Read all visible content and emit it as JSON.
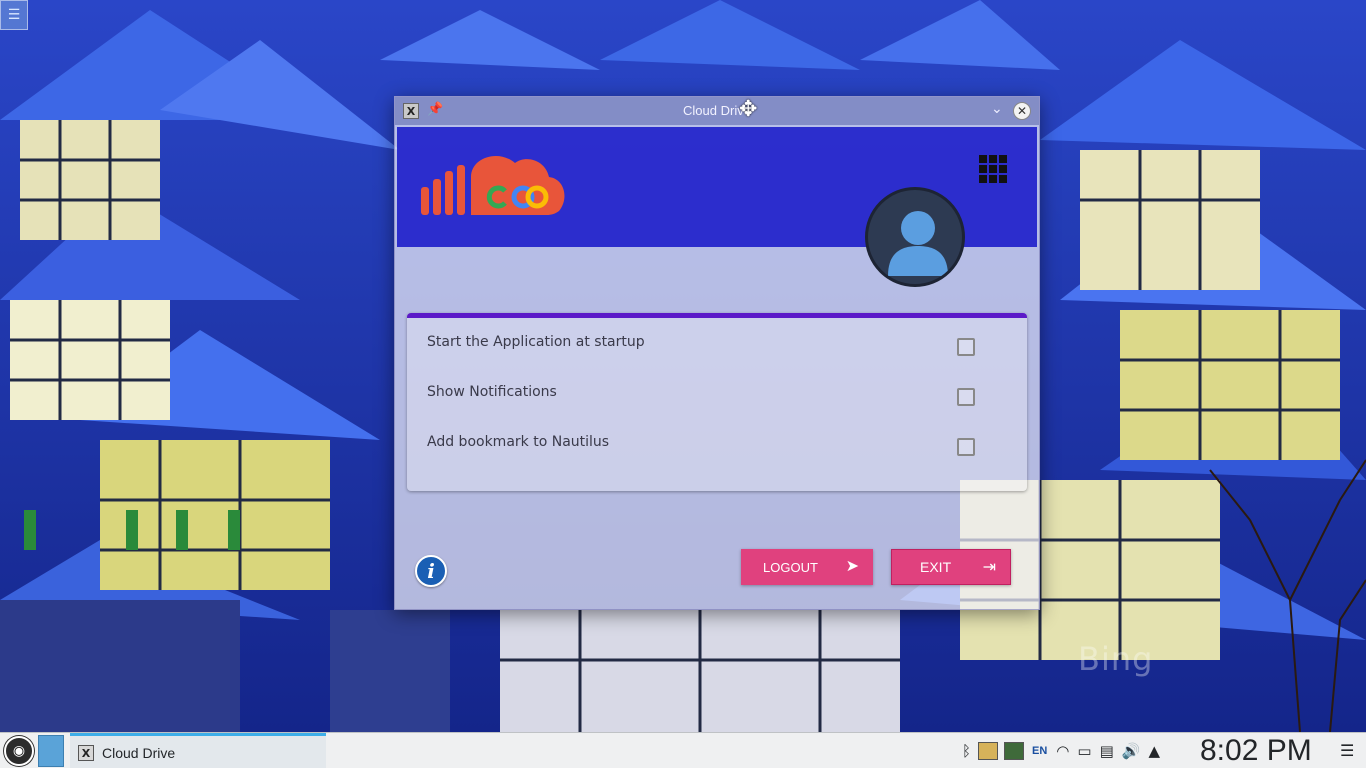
{
  "window": {
    "title": "Cloud Drive",
    "settings": [
      {
        "label": "Start the Application at startup",
        "checked": false
      },
      {
        "label": "Show Notifications",
        "checked": false
      },
      {
        "label": "Add bookmark to Nautilus",
        "checked": false
      }
    ],
    "buttons": {
      "logout": "LOGOUT",
      "exit": "EXIT"
    },
    "accent_color": "#e0417e",
    "header_color": "#1414c8",
    "card_accent": "#5b19c8"
  },
  "wallpaper": {
    "watermark": "Bing"
  },
  "taskbar": {
    "task_label": "Cloud Drive",
    "language": "EN",
    "clock": "8:02 PM",
    "icons": [
      "start-menu-icon",
      "pager-icon",
      "bluetooth-icon",
      "clipboard-icon",
      "monitor-icon",
      "wifi-icon",
      "battery-icon",
      "notes-icon",
      "volume-icon",
      "expand-tray-icon",
      "hamburger-menu-icon"
    ]
  }
}
